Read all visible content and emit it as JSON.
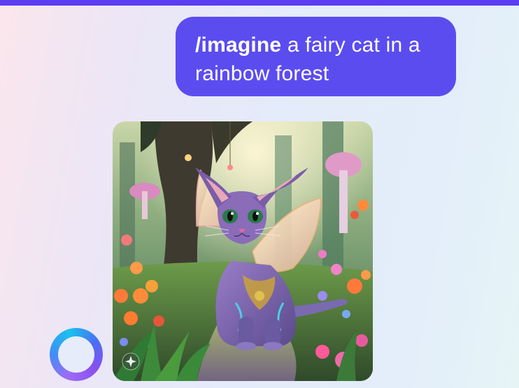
{
  "message": {
    "command": "/imagine",
    "prompt_text": " a fairy cat in a rainbow forest"
  },
  "generated_image": {
    "subject": "fairy-cat-in-rainbow-forest"
  },
  "icons": {
    "assistant": "ai-ring-icon",
    "watermark": "sparkle-watermark-icon"
  },
  "colors": {
    "accent": "#5b4cf0",
    "top_bar": "#5b3df2",
    "bubble_text": "#ffffff"
  }
}
